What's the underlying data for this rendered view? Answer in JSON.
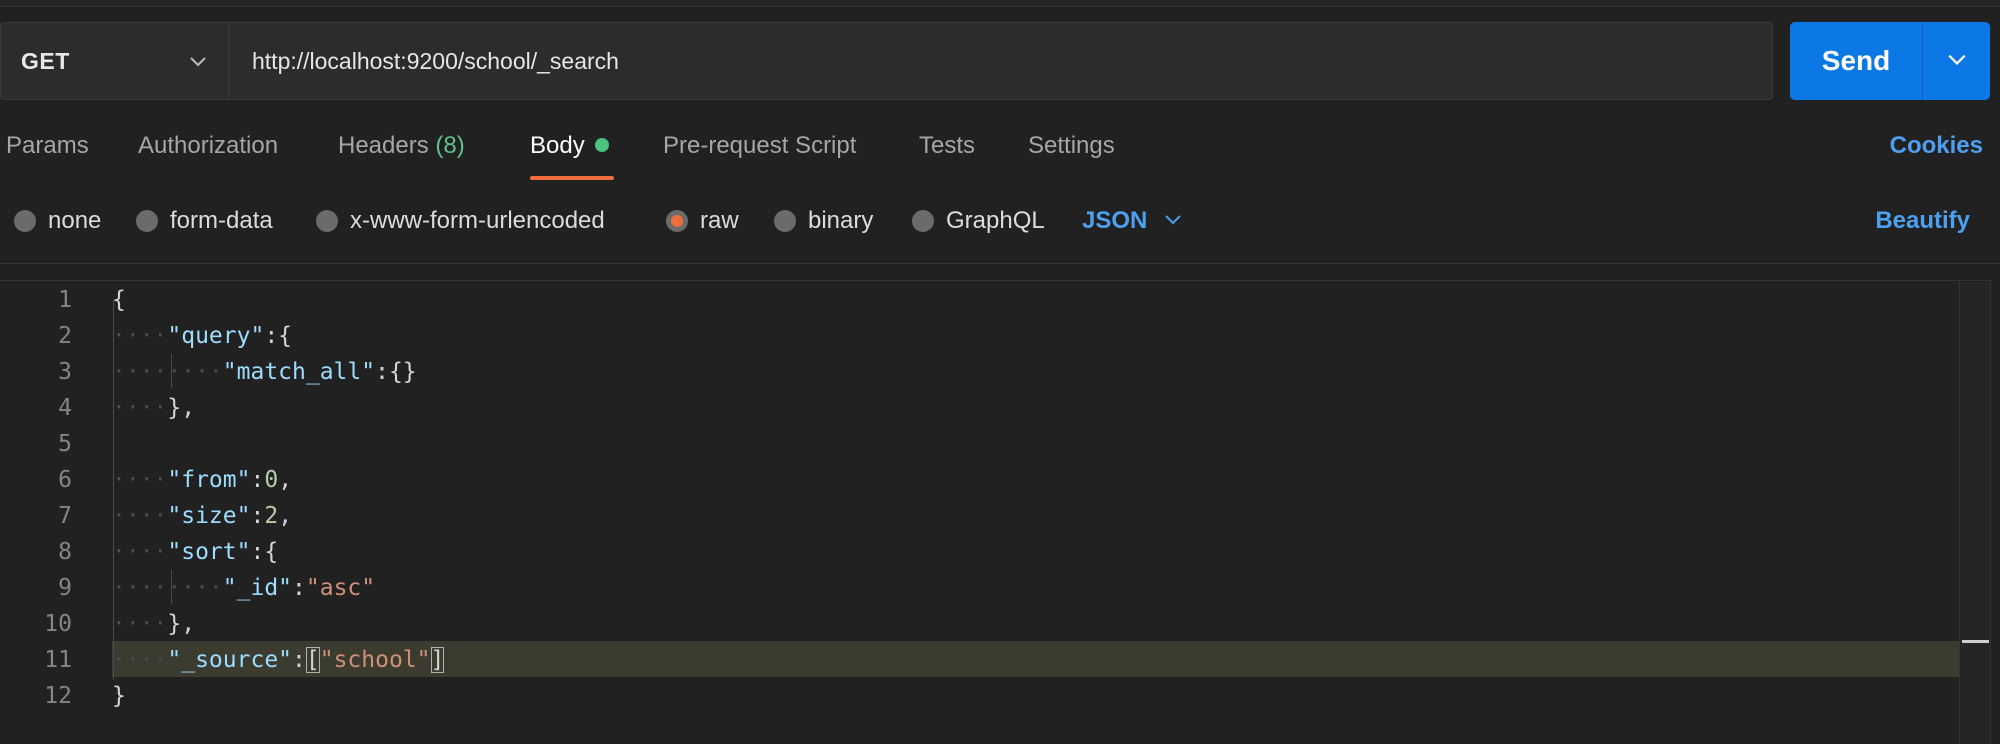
{
  "request": {
    "method": "GET",
    "url": "http://localhost:9200/school/_search",
    "send_label": "Send"
  },
  "tabs": [
    {
      "label": "Params"
    },
    {
      "label": "Authorization"
    },
    {
      "label": "Headers",
      "count": "(8)"
    },
    {
      "label": "Body",
      "active": true
    },
    {
      "label": "Pre-request Script"
    },
    {
      "label": "Tests"
    },
    {
      "label": "Settings"
    }
  ],
  "cookies_label": "Cookies",
  "body_types": [
    {
      "label": "none"
    },
    {
      "label": "form-data"
    },
    {
      "label": "x-www-form-urlencoded"
    },
    {
      "label": "raw",
      "selected": true
    },
    {
      "label": "binary"
    },
    {
      "label": "GraphQL"
    }
  ],
  "body_format": "JSON",
  "beautify_label": "Beautify",
  "editor": {
    "line_numbers": [
      "1",
      "2",
      "3",
      "4",
      "5",
      "6",
      "7",
      "8",
      "9",
      "10",
      "11",
      "12"
    ],
    "active_line": "11",
    "lines": [
      [
        {
          "t": "p",
          "v": "{"
        }
      ],
      [
        {
          "t": "ws",
          "v": "····"
        },
        {
          "t": "k",
          "v": "\"query\""
        },
        {
          "t": "p",
          "v": ":{"
        }
      ],
      [
        {
          "t": "ws",
          "v": "····"
        },
        {
          "t": "ws",
          "v": "····"
        },
        {
          "t": "k",
          "v": "\"match_all\""
        },
        {
          "t": "p",
          "v": ":{}"
        }
      ],
      [
        {
          "t": "ws",
          "v": "····"
        },
        {
          "t": "p",
          "v": "},"
        }
      ],
      [],
      [
        {
          "t": "ws",
          "v": "····"
        },
        {
          "t": "k",
          "v": "\"from\""
        },
        {
          "t": "p",
          "v": ":"
        },
        {
          "t": "n",
          "v": "0"
        },
        {
          "t": "p",
          "v": ","
        }
      ],
      [
        {
          "t": "ws",
          "v": "····"
        },
        {
          "t": "k",
          "v": "\"size\""
        },
        {
          "t": "p",
          "v": ":"
        },
        {
          "t": "n",
          "v": "2"
        },
        {
          "t": "p",
          "v": ","
        }
      ],
      [
        {
          "t": "ws",
          "v": "····"
        },
        {
          "t": "k",
          "v": "\"sort\""
        },
        {
          "t": "p",
          "v": ":{"
        }
      ],
      [
        {
          "t": "ws",
          "v": "····"
        },
        {
          "t": "ws",
          "v": "····"
        },
        {
          "t": "k",
          "v": "\"_id\""
        },
        {
          "t": "p",
          "v": ":"
        },
        {
          "t": "s",
          "v": "\"asc\""
        }
      ],
      [
        {
          "t": "ws",
          "v": "····"
        },
        {
          "t": "p",
          "v": "},"
        }
      ],
      [
        {
          "t": "ws",
          "v": "····"
        },
        {
          "t": "k",
          "v": "\"_source\""
        },
        {
          "t": "p",
          "v": ":"
        },
        {
          "t": "p bm",
          "v": "["
        },
        {
          "t": "s",
          "v": "\"school\""
        },
        {
          "t": "p bm",
          "v": "]"
        }
      ],
      [
        {
          "t": "p",
          "v": "}"
        }
      ]
    ]
  },
  "icons": {
    "method_dropdown": "chevron-down-icon",
    "send_dropdown": "chevron-down-icon",
    "format_dropdown": "chevron-down-icon"
  },
  "colors": {
    "send_button": "#0c78e6",
    "active_tab_underline": "#ef6c3d",
    "link": "#4d9ff0",
    "body_dot": "#49c37f"
  }
}
